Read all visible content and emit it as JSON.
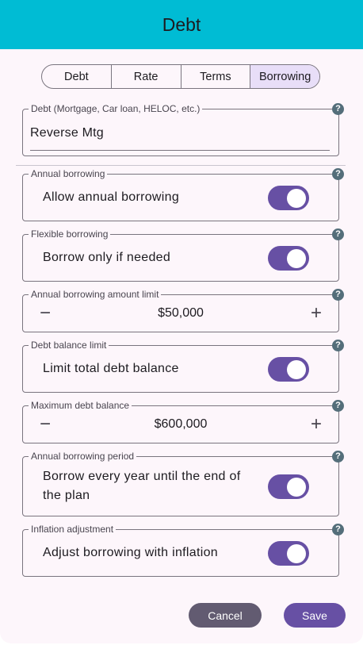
{
  "header": {
    "title": "Debt"
  },
  "tabs": [
    {
      "label": "Debt"
    },
    {
      "label": "Rate"
    },
    {
      "label": "Terms"
    },
    {
      "label": "Borrowing"
    }
  ],
  "active_tab": "Borrowing",
  "help_glyph": "?",
  "debt_name": {
    "label": "Debt (Mortgage, Car loan, HELOC, etc.)",
    "value": "Reverse Mtg"
  },
  "annual_borrowing": {
    "label": "Annual borrowing",
    "text": "Allow annual borrowing",
    "on": true
  },
  "flexible_borrowing": {
    "label": "Flexible borrowing",
    "text": "Borrow only if needed",
    "on": true
  },
  "annual_limit": {
    "label": "Annual borrowing amount limit",
    "value": "$50,000",
    "decrement": "−",
    "increment": "+"
  },
  "balance_limit": {
    "label": "Debt balance limit",
    "text": "Limit total debt balance",
    "on": true
  },
  "max_balance": {
    "label": "Maximum debt balance",
    "value": "$600,000",
    "decrement": "−",
    "increment": "+"
  },
  "borrowing_period": {
    "label": "Annual borrowing period",
    "line1": "Borrow every year until the end of",
    "line2": "the plan",
    "on": true
  },
  "inflation_adjustment": {
    "label": "Inflation adjustment",
    "text": "Adjust borrowing with inflation",
    "on": true
  },
  "actions": {
    "cancel": "Cancel",
    "save": "Save"
  },
  "colors": {
    "header": "#00bcd4",
    "primary": "#6750a4",
    "secondary": "#625b71",
    "tab_active": "#e8def8",
    "help_icon": "#546e7a"
  }
}
